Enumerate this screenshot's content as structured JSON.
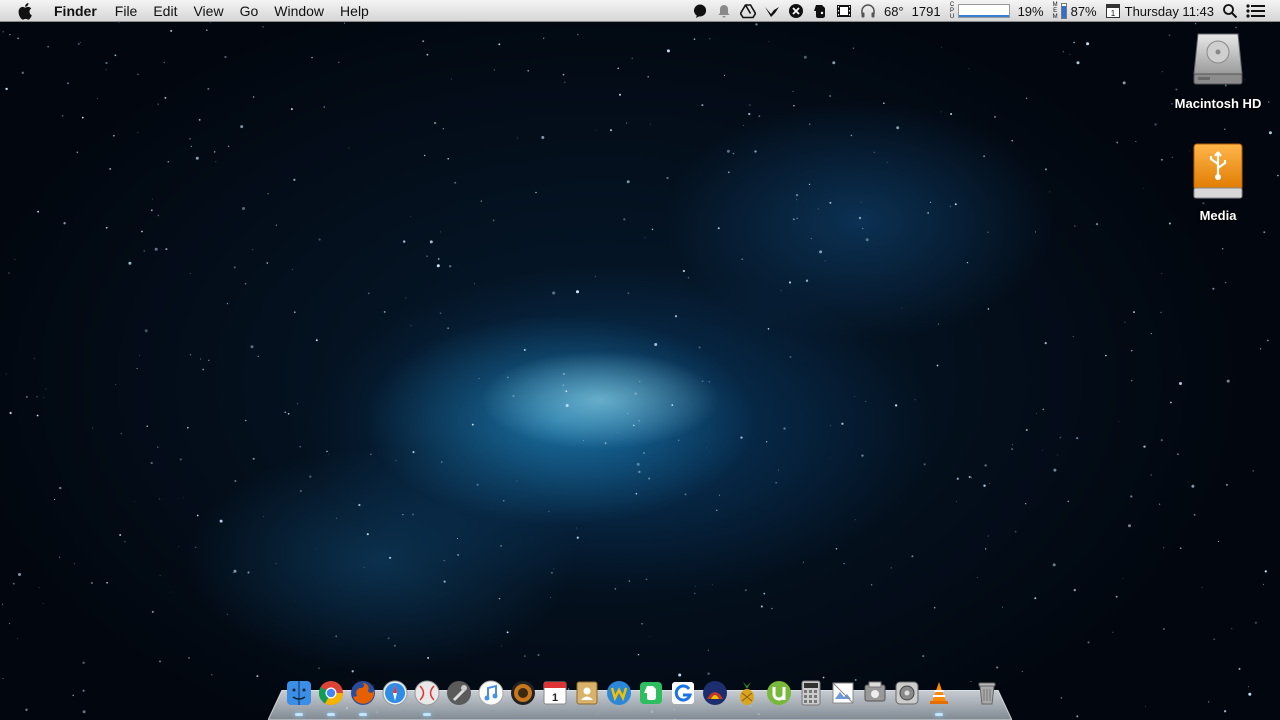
{
  "menubar": {
    "app_name": "Finder",
    "menus": [
      "File",
      "Edit",
      "View",
      "Go",
      "Window",
      "Help"
    ],
    "status": {
      "weather": "68°",
      "counter": "1791",
      "cpu_label": [
        "C",
        "P",
        "U"
      ],
      "cpu_percent": "19%",
      "cpu_fraction": 0.19,
      "mem_label": [
        "M",
        "E",
        "M"
      ],
      "mem_percent": "87%",
      "mem_fraction": 0.87,
      "calendar_day": "1",
      "clock": "Thursday 11:43"
    },
    "status_icons": [
      "notification-bubble-icon",
      "bell-icon",
      "google-drive-icon",
      "crane-icon",
      "xmarks-icon",
      "evernote-icon",
      "film-strip-icon",
      "headphones-icon",
      "search-icon",
      "list-icon"
    ]
  },
  "desktop": {
    "icons": [
      {
        "label": "Macintosh HD",
        "icon": "hard-drive-icon"
      },
      {
        "label": "Media",
        "icon": "usb-drive-icon"
      }
    ]
  },
  "dock": {
    "apps": [
      {
        "name": "finder",
        "color": "#3a8ee6",
        "running": true
      },
      {
        "name": "chrome",
        "color": "#dd4b39",
        "running": true
      },
      {
        "name": "firefox",
        "color": "#e66000",
        "running": true
      },
      {
        "name": "safari",
        "color": "#2c8ce8",
        "running": false
      },
      {
        "name": "ball",
        "color": "#e8e8e8",
        "running": true
      },
      {
        "name": "launchpad",
        "color": "#7a7a7a",
        "running": false
      },
      {
        "name": "itunes",
        "color": "#4a90e2",
        "running": false
      },
      {
        "name": "speaker",
        "color": "#c8771e",
        "running": false
      },
      {
        "name": "calendar",
        "color": "#ffffff",
        "running": false
      },
      {
        "name": "contacts",
        "color": "#d9b26a",
        "running": false
      },
      {
        "name": "wunderlist",
        "color": "#f2c200",
        "running": false
      },
      {
        "name": "evernote",
        "color": "#2dbe60",
        "running": false
      },
      {
        "name": "grammar-g",
        "color": "#1a73e8",
        "running": false
      },
      {
        "name": "fireworks",
        "color": "#c0392b",
        "running": false
      },
      {
        "name": "pineapple",
        "color": "#d9a520",
        "running": false
      },
      {
        "name": "utorrent",
        "color": "#78b83a",
        "running": false
      },
      {
        "name": "calculator",
        "color": "#cccccc",
        "running": false
      },
      {
        "name": "preview",
        "color": "#bbbbbb",
        "running": false
      },
      {
        "name": "system-info",
        "color": "#999999",
        "running": false
      },
      {
        "name": "system-preferences",
        "color": "#8a8a8a",
        "running": false
      },
      {
        "name": "vlc",
        "color": "#ff8800",
        "running": true
      },
      {
        "name": "trash",
        "color": "#aaaaaa",
        "running": false
      }
    ]
  }
}
